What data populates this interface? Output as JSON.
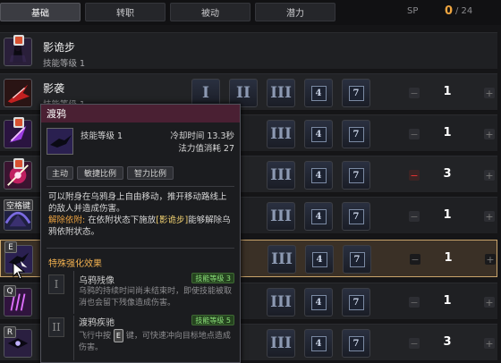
{
  "tabs": [
    {
      "label": "基础",
      "active": true
    },
    {
      "label": "转职"
    },
    {
      "label": "被动"
    },
    {
      "label": "潜力"
    }
  ],
  "sp": {
    "label": "SP",
    "current": "0",
    "max": "/ 24"
  },
  "skills": [
    {
      "name": "影诡步",
      "level": "技能等级 1"
    },
    {
      "name": "影袭",
      "level": "技能等级 1",
      "value": "1"
    },
    {
      "value": "1"
    },
    {
      "value": "3"
    },
    {
      "key": "空格键",
      "value": "1"
    },
    {
      "key": "E",
      "value": "1"
    },
    {
      "key": "Q",
      "value": "1"
    },
    {
      "key": "R",
      "value": "3"
    }
  ],
  "runes": {
    "r1": "I",
    "r2": "II",
    "r3": "III",
    "r4": "4",
    "r5": "7"
  },
  "tooltip": {
    "title": "渡鸦",
    "level": "技能等级 1",
    "cooldown": "冷却时间 13.3秒",
    "mp": "法力值消耗 27",
    "tags": [
      "主动",
      "敏捷比例",
      "智力比例"
    ],
    "desc1": "可以附身在乌鸦身上自由移动，推开移动路线上的敌人并造成伤害。",
    "detach_label": "解除依附:",
    "detach_text1": "在依附状态下施放",
    "detach_skill": "[影诡步]",
    "detach_text2": "能够解除乌鸦依附状态。",
    "enh_title": "特殊强化效果",
    "enh": [
      {
        "num": "I",
        "name": "乌鸦残像",
        "tag": "技能等级 3",
        "desc": "乌鸦的持续时间尚未结束时，即使技能被取消也会留下残像造成伤害。"
      },
      {
        "num": "II",
        "name": "渡鸦疾驰",
        "tag": "技能等级 5",
        "desc_a": "飞行中按",
        "key": "E",
        "desc_b": "键，可快速冲向目标地点造成伤害。"
      }
    ]
  }
}
